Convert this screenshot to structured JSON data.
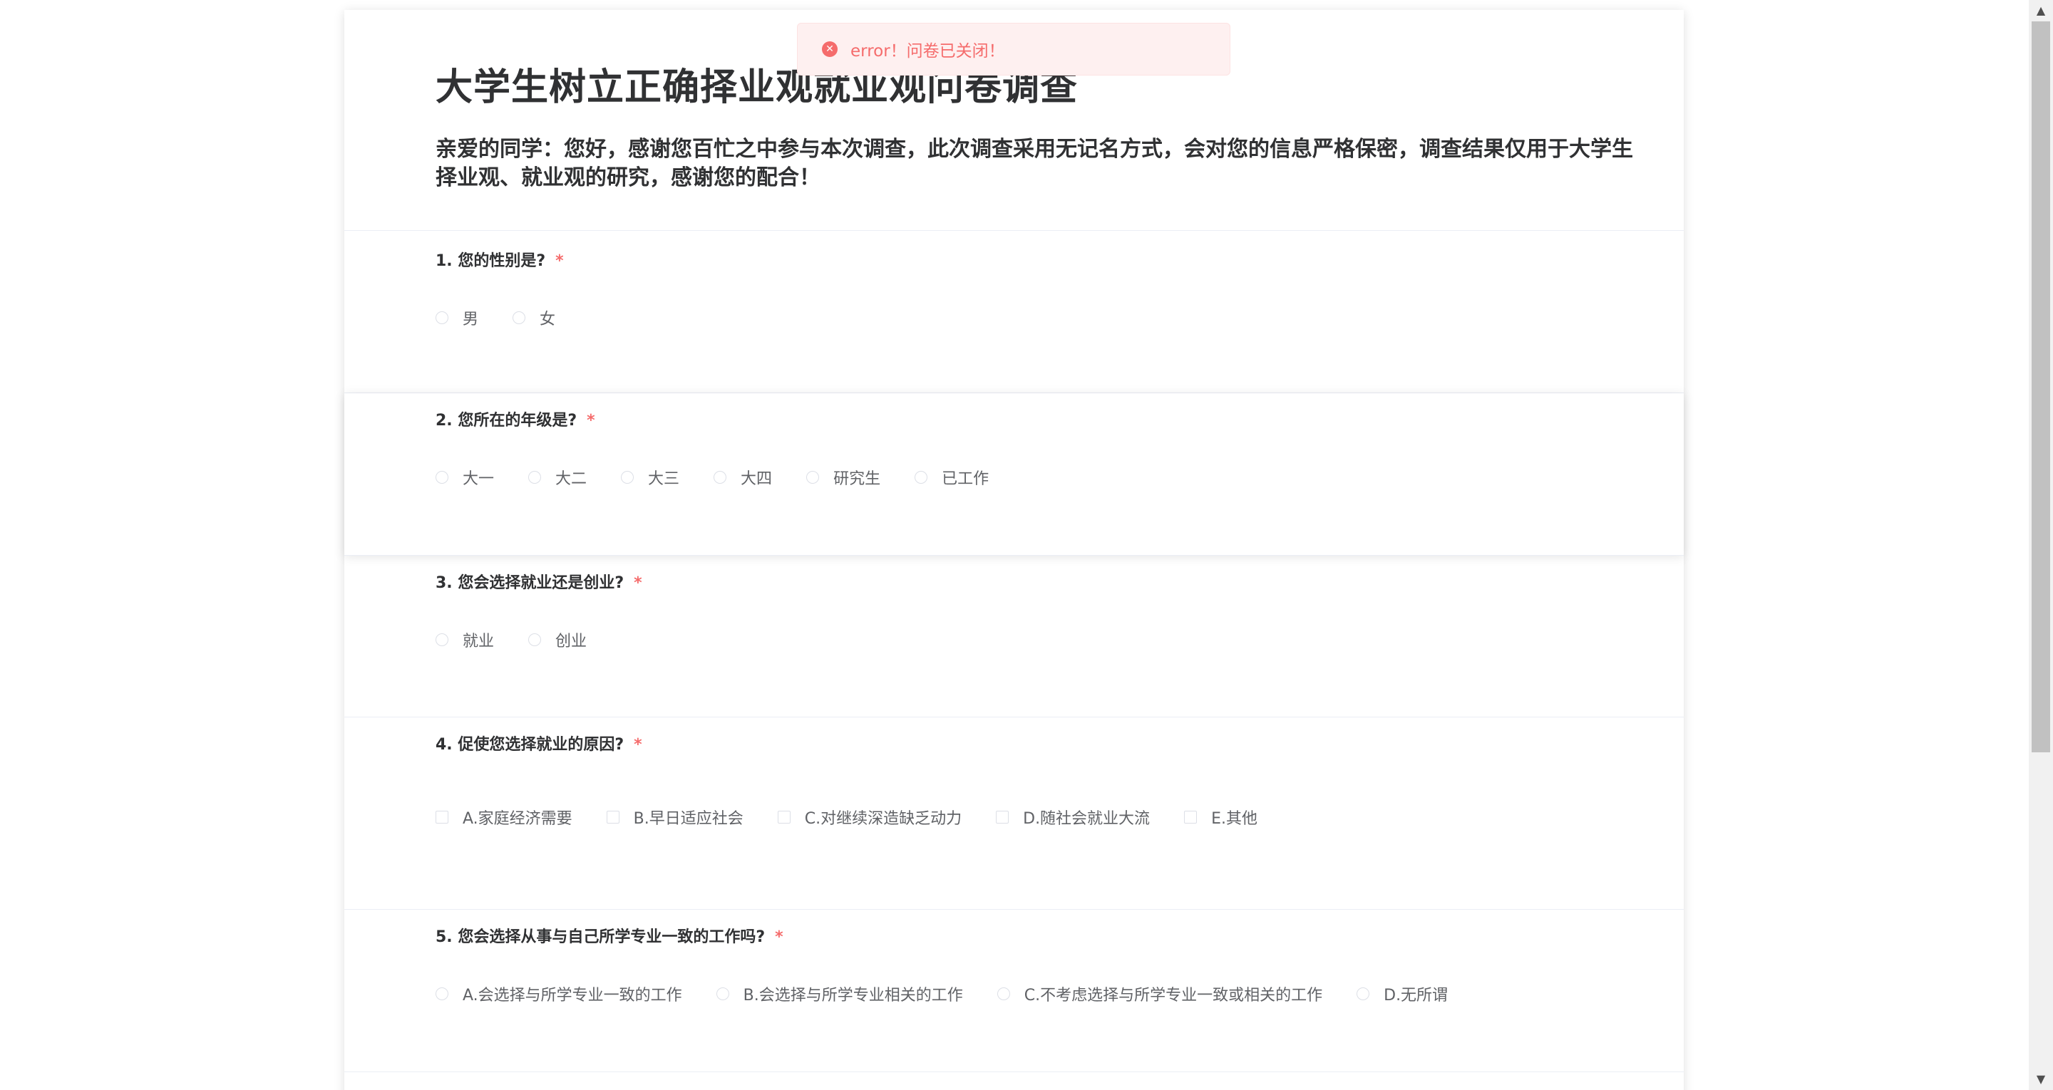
{
  "toast": {
    "icon": "error-circle-icon",
    "text": "error！问卷已关闭！",
    "color": "#f56c6c"
  },
  "survey": {
    "title": "大学生树立正确择业观就业观问卷调查",
    "description": "亲爱的同学：您好，感谢您百忙之中参与本次调查，此次调查采用无记名方式，会对您的信息严格保密，调查结果仅用于大学生择业观、就业观的研究，感谢您的配合！",
    "required_mark": "*",
    "questions": [
      {
        "title": "1. 您的性别是?",
        "type": "radio",
        "options": [
          "男",
          "女"
        ]
      },
      {
        "title": "2. 您所在的年级是?",
        "type": "radio",
        "options": [
          "大一",
          "大二",
          "大三",
          "大四",
          "研究生",
          "已工作"
        ]
      },
      {
        "title": "3. 您会选择就业还是创业?",
        "type": "radio",
        "options": [
          "就业",
          "创业"
        ]
      },
      {
        "title": "4. 促使您选择就业的原因?",
        "type": "checkbox",
        "options": [
          "A.家庭经济需要",
          "B.早日适应社会",
          "C.对继续深造缺乏动力",
          "D.随社会就业大流",
          "E.其他"
        ]
      },
      {
        "title": "5. 您会选择从事与自己所学专业一致的工作吗?",
        "type": "radio",
        "options": [
          "A.会选择与所学专业一致的工作",
          "B.会选择与所学专业相关的工作",
          "C.不考虑选择与所学专业一致或相关的工作",
          "D.无所谓"
        ]
      }
    ]
  },
  "scrollbar": {
    "up_icon": "scroll-up-arrow-icon",
    "down_icon": "scroll-down-arrow-icon"
  }
}
